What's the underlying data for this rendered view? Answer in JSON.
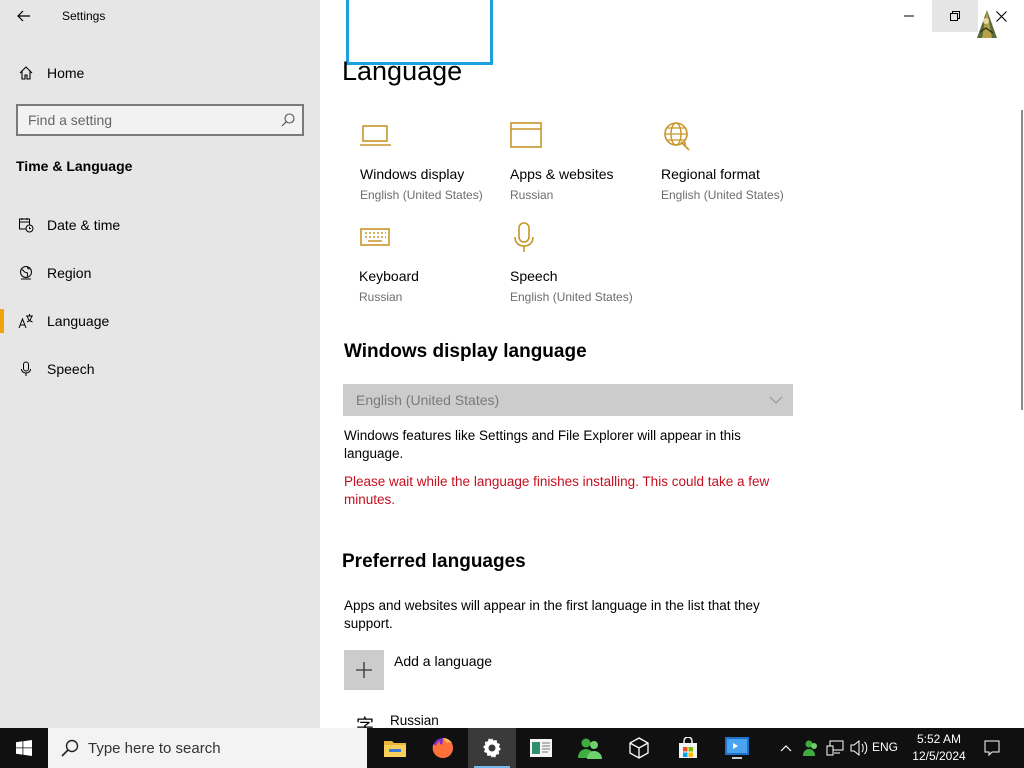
{
  "window": {
    "title": "Settings",
    "minimize_icon": "minimize-icon",
    "restore_icon": "restore-icon",
    "close_icon": "close-icon"
  },
  "sidebar": {
    "home_label": "Home",
    "search_placeholder": "Find a setting",
    "section_title": "Time & Language",
    "items": [
      {
        "label": "Date & time",
        "icon": "calendar-clock-icon",
        "active": false
      },
      {
        "label": "Region",
        "icon": "globe-icon",
        "active": false
      },
      {
        "label": "Language",
        "icon": "language-icon",
        "active": true
      },
      {
        "label": "Speech",
        "icon": "microphone-icon",
        "active": false
      }
    ]
  },
  "main": {
    "title": "Language",
    "tiles": [
      {
        "name": "Windows display",
        "sub": "English (United States)",
        "icon": "monitor-icon"
      },
      {
        "name": "Apps & websites",
        "sub": "Russian",
        "icon": "browser-window-icon"
      },
      {
        "name": "Regional format",
        "sub": "English (United States)",
        "icon": "globe-format-icon"
      },
      {
        "name": "Keyboard",
        "sub": "Russian",
        "icon": "keyboard-icon"
      },
      {
        "name": "Speech",
        "sub": "English (United States)",
        "icon": "microphone-icon"
      }
    ],
    "display_language": {
      "heading": "Windows display language",
      "selected": "English (United States)",
      "description": "Windows features like Settings and File Explorer will appear in this language.",
      "warning": "Please wait while the language finishes installing. This could take a few minutes."
    },
    "preferred": {
      "heading": "Preferred languages",
      "description": "Apps and websites will appear in the first language in the list that they support.",
      "add_label": "Add a language",
      "languages": [
        {
          "glyph": "字",
          "name": "Russian"
        }
      ]
    }
  },
  "taskbar": {
    "search_placeholder": "Type here to search",
    "apps": [
      {
        "name": "file-explorer-icon"
      },
      {
        "name": "firefox-icon"
      },
      {
        "name": "settings-gear-icon",
        "active": true
      },
      {
        "name": "document-app-icon"
      },
      {
        "name": "people-app-icon"
      },
      {
        "name": "3d-box-icon"
      },
      {
        "name": "store-icon"
      },
      {
        "name": "remote-desktop-icon"
      }
    ],
    "input_language": "ENG",
    "time": "5:52 AM",
    "date": "12/5/2024"
  },
  "colors": {
    "accent": "#f0a30a",
    "icon_gold": "#c7962a",
    "warning": "#c50f1f",
    "focus": "#1ba1e2"
  }
}
